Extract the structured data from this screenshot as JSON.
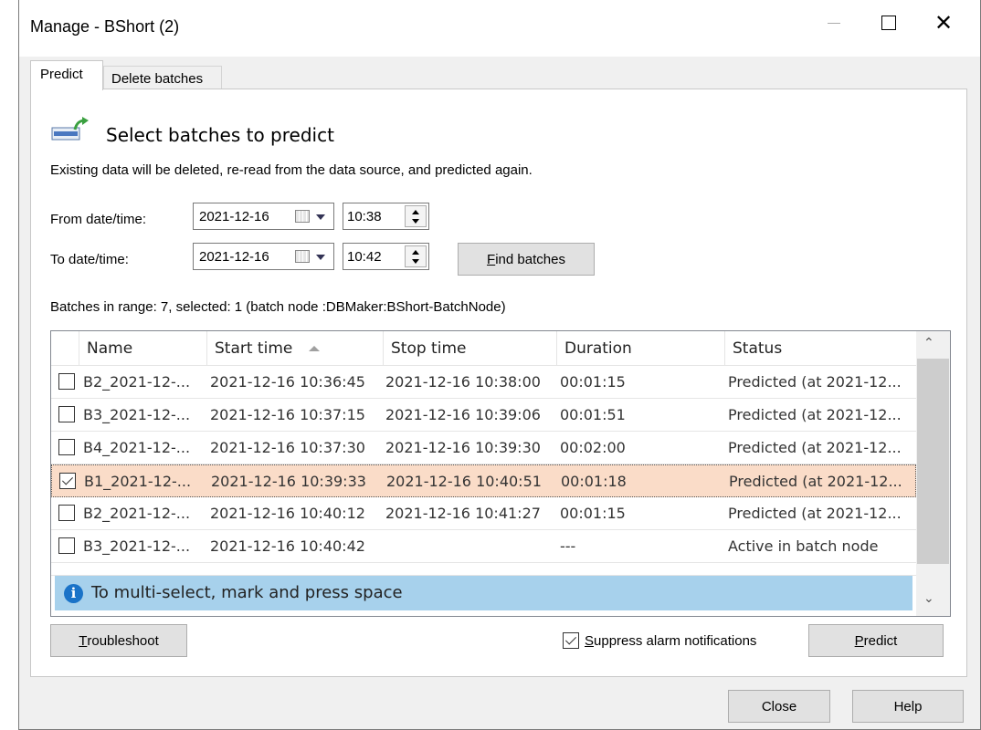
{
  "window": {
    "title": "Manage - BShort (2)"
  },
  "tabs": [
    {
      "label": "Predict",
      "active": true
    },
    {
      "label": "Delete batches",
      "active": false
    }
  ],
  "section": {
    "title": "Select batches to predict",
    "description": "Existing data will be deleted, re-read from the data source, and predicted again."
  },
  "from": {
    "label": "From date/time:",
    "date": "2021-12-16",
    "time": "10:38"
  },
  "to": {
    "label": "To date/time:",
    "date": "2021-12-16",
    "time": "10:42"
  },
  "find_batches": {
    "prefix": "",
    "mnemonic": "F",
    "rest": "ind batches"
  },
  "summary": "Batches in range: 7, selected: 1 (batch node :DBMaker:BShort-BatchNode)",
  "table": {
    "columns": [
      "Name",
      "Start time",
      "Stop time",
      "Duration",
      "Status"
    ],
    "rows": [
      {
        "checked": false,
        "name": "B2_2021-12-...",
        "start": "2021-12-16 10:36:45",
        "stop": "2021-12-16 10:38:00",
        "duration": "00:01:15",
        "status": "Predicted (at 2021-12...",
        "selected": false
      },
      {
        "checked": false,
        "name": "B3_2021-12-...",
        "start": "2021-12-16 10:37:15",
        "stop": "2021-12-16 10:39:06",
        "duration": "00:01:51",
        "status": "Predicted (at 2021-12...",
        "selected": false
      },
      {
        "checked": false,
        "name": "B4_2021-12-...",
        "start": "2021-12-16 10:37:30",
        "stop": "2021-12-16 10:39:30",
        "duration": "00:02:00",
        "status": "Predicted (at 2021-12...",
        "selected": false
      },
      {
        "checked": true,
        "name": "B1_2021-12-...",
        "start": "2021-12-16 10:39:33",
        "stop": "2021-12-16 10:40:51",
        "duration": "00:01:18",
        "status": "Predicted (at 2021-12...",
        "selected": true
      },
      {
        "checked": false,
        "name": "B2_2021-12-...",
        "start": "2021-12-16 10:40:12",
        "stop": "2021-12-16 10:41:27",
        "duration": "00:01:15",
        "status": "Predicted (at 2021-12...",
        "selected": false
      },
      {
        "checked": false,
        "name": "B3_2021-12-...",
        "start": "2021-12-16 10:40:42",
        "stop": "",
        "duration": "---",
        "status": "Active in batch node",
        "selected": false
      }
    ]
  },
  "info": "To multi-select, mark and press space",
  "troubleshoot": {
    "mnemonic": "T",
    "rest": "roubleshoot"
  },
  "suppress": {
    "mnemonic": "S",
    "rest": "uppress alarm notifications",
    "checked": true
  },
  "predict": {
    "mnemonic": "P",
    "rest": "redict"
  },
  "close": "Close",
  "help": "Help"
}
